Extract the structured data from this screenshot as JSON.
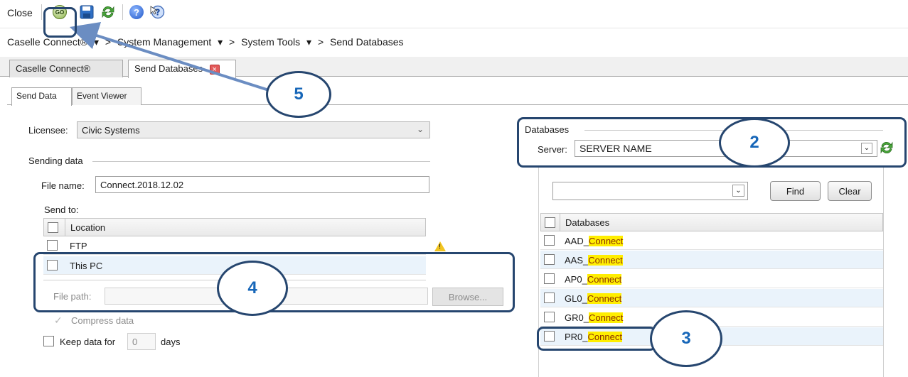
{
  "toolbar": {
    "close_label": "Close",
    "go_label": "GO",
    "icons": [
      "go-icon",
      "save-icon",
      "refresh-icon",
      "help-icon",
      "whats-this-icon"
    ]
  },
  "breadcrumb": {
    "items": [
      "Caselle Connect®",
      "System Management",
      "System Tools",
      "Send Databases"
    ],
    "separator": ">",
    "dropdown_glyph": "▾"
  },
  "tabs": {
    "documents": [
      "Caselle Connect®",
      "Send Databases"
    ],
    "close_glyph": "×",
    "sub": [
      "Send Data",
      "Event Viewer"
    ]
  },
  "form": {
    "licensee_label": "Licensee:",
    "licensee_value": "Civic Systems",
    "sending_group": "Sending data",
    "file_name_label": "File name:",
    "file_name_value": "Connect.2018.12.02",
    "send_to_label": "Send to:",
    "location_header": "Location",
    "locations": [
      "FTP",
      "This PC"
    ],
    "file_path_label": "File path:",
    "file_path_value": "",
    "browse_label": "Browse...",
    "compress_label": "Compress data",
    "keep_label": "Keep data for",
    "keep_value": "0",
    "days_label": "days",
    "warning_glyph": "!"
  },
  "databases": {
    "group_label": "Databases",
    "server_label": "Server:",
    "server_value": "SERVER NAME",
    "search_value": "",
    "find_label": "Find",
    "clear_label": "Clear",
    "column_header": "Databases",
    "rows": [
      {
        "prefix": "AAD_",
        "match": "Connect"
      },
      {
        "prefix": "AAS_",
        "match": "Connect"
      },
      {
        "prefix": "AP0_",
        "match": "Connect"
      },
      {
        "prefix": "GL0_",
        "match": "Connect"
      },
      {
        "prefix": "GR0_",
        "match": "Connect"
      },
      {
        "prefix": "PR0_",
        "match": "Connect"
      }
    ]
  },
  "callouts": [
    "5",
    "2",
    "4",
    "3"
  ],
  "colors": {
    "highlight": "#ffee00",
    "callout_border": "#26466f",
    "callout_text": "#1666b8",
    "row_alt": "#eaf3fb"
  }
}
